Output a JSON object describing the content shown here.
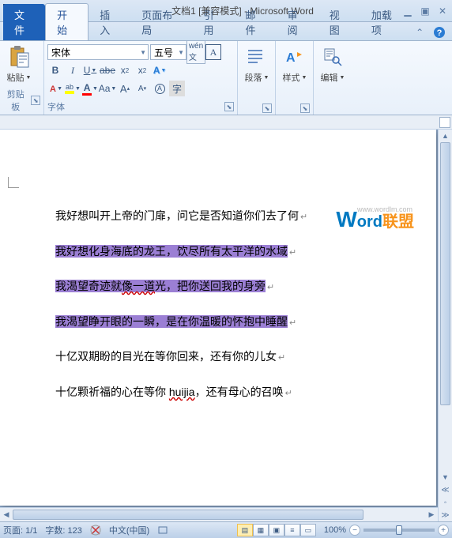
{
  "title": "文档1 [兼容模式] - Microsoft Word",
  "app_letter": "W",
  "tabs": {
    "file": "文件",
    "items": [
      "开始",
      "插入",
      "页面布局",
      "引用",
      "邮件",
      "审阅",
      "视图",
      "加载项"
    ],
    "active": 0
  },
  "ribbon": {
    "clipboard": {
      "paste": "粘贴",
      "label": "剪贴板"
    },
    "font": {
      "name": "宋体",
      "size": "五号",
      "label": "字体"
    },
    "paragraph": {
      "btn": "段落"
    },
    "styles": {
      "btn": "样式"
    },
    "editing": {
      "btn": "编辑"
    }
  },
  "document": {
    "lines": [
      {
        "text": "我好想叫开上帝的门扉，问它是否知道你们去了何",
        "hl": false
      },
      {
        "text": "我好想化身海底的龙王，饮尽所有太平洋的水域",
        "hl": true
      },
      {
        "text": "我渴望奇迹就像一道光，把你送回我的身旁",
        "hl": true,
        "wavy_range": [
          6,
          9
        ]
      },
      {
        "text": "我渴望睁开眼的一瞬，是在你温暖的怀抱中睡醒",
        "hl": true
      },
      {
        "text": "十亿双期盼的目光在等你回来，还有你的儿女",
        "hl": false
      },
      {
        "text_pre": "十亿颗祈福的心在等你 ",
        "wavy_word": "huijia",
        "text_post": "，还有母心的召唤",
        "hl": false
      }
    ]
  },
  "watermark": {
    "w": "W",
    "ord": "ord",
    "lm": "联盟",
    "url": "www.wordlm.com"
  },
  "status": {
    "page": "页面: 1/1",
    "words": "字数: 123",
    "lang": "中文(中国)",
    "zoom": "100%"
  }
}
